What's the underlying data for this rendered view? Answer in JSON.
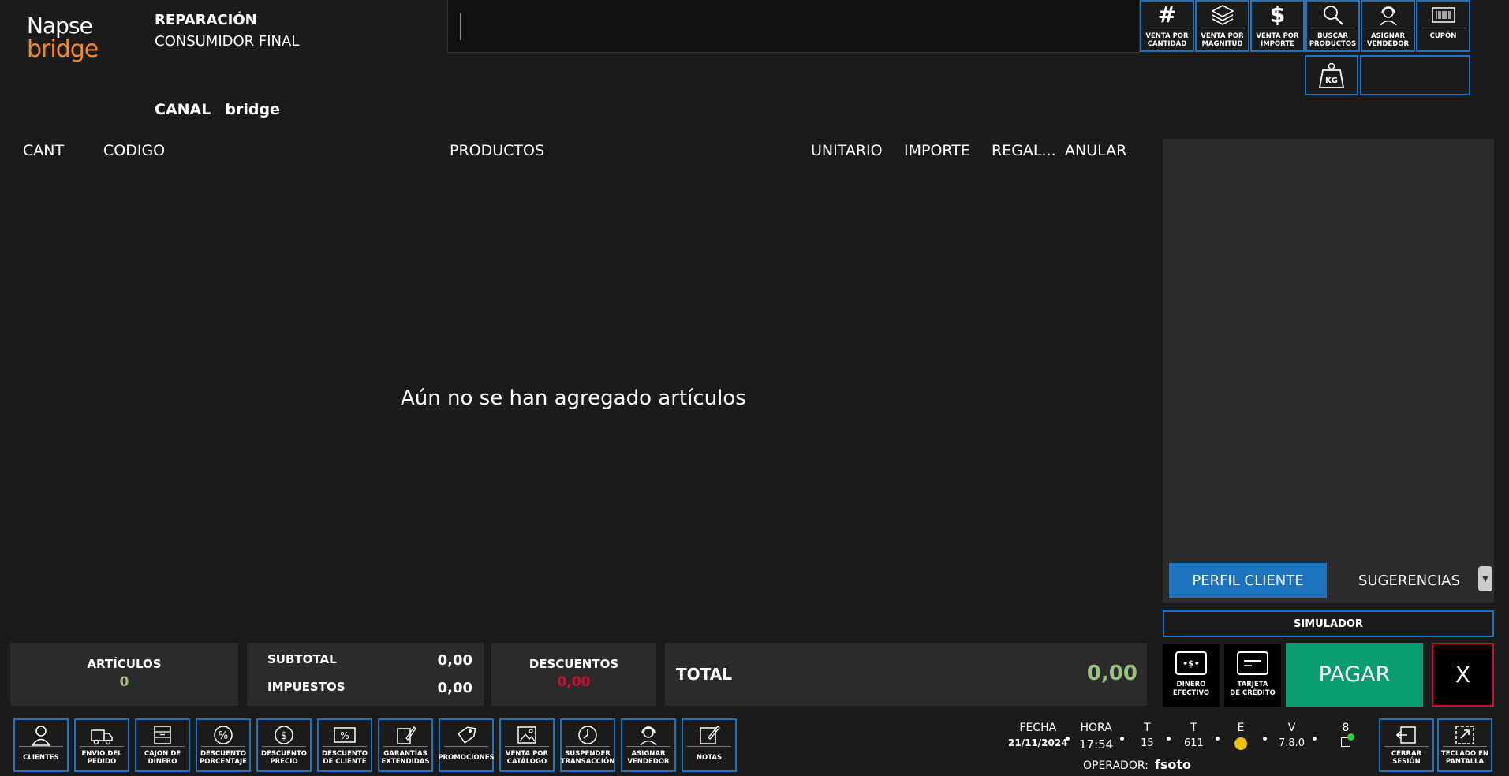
{
  "logo": {
    "line1": "Napse",
    "line2": "bridge"
  },
  "header": {
    "title": "REPARACIÓN",
    "subtitle": "CONSUMIDOR FINAL",
    "canal_label": "CANAL",
    "canal_value": "bridge"
  },
  "toolbar": [
    {
      "icon": "#",
      "label1": "VENTA POR",
      "label2": "CANTIDAD"
    },
    {
      "icon": "layers",
      "label1": "VENTA POR",
      "label2": "MAGNITUD"
    },
    {
      "icon": "$",
      "label1": "VENTA POR",
      "label2": "IMPORTE"
    },
    {
      "icon": "search",
      "label1": "BUSCAR",
      "label2": "PRODUCTOS"
    },
    {
      "icon": "headset",
      "label1": "ASIGNAR",
      "label2": "VENDEDOR"
    },
    {
      "icon": "barcode",
      "label1": "CUPÓN",
      "label2": ""
    }
  ],
  "kg_label": "KG",
  "table": {
    "columns": [
      "CANT",
      "CODIGO",
      "PRODUCTOS",
      "UNITARIO",
      "IMPORTE",
      "REGAL...",
      "ANULAR"
    ],
    "empty_message": "Aún no se han agregado artículos"
  },
  "tabs": {
    "perfil": "PERFIL CLIENTE",
    "sugerencias": "SUGERENCIAS"
  },
  "simulador": "SIMULADOR",
  "summary": {
    "articulos_label": "ARTÍCULOS",
    "articulos_value": "0",
    "subtotal_label": "SUBTOTAL",
    "subtotal_value": "0,00",
    "impuestos_label": "IMPUESTOS",
    "impuestos_value": "0,00",
    "descuentos_label": "DESCUENTOS",
    "descuentos_value": "0,00",
    "total_label": "TOTAL",
    "total_value": "0,00"
  },
  "payment": {
    "efectivo1": "DINERO",
    "efectivo2": "EFECTIVO",
    "tarjeta1": "TARJETA",
    "tarjeta2": "DE CRÉDITO",
    "pagar": "PAGAR",
    "cancel": "X"
  },
  "bottom_buttons": [
    {
      "label1": "CLIENTES",
      "label2": ""
    },
    {
      "label1": "ENVIO DEL",
      "label2": "PEDIDO"
    },
    {
      "label1": "CAJON DE",
      "label2": "DINERO"
    },
    {
      "label1": "DESCUENTO",
      "label2": "PORCENTAJE"
    },
    {
      "label1": "DESCUENTO",
      "label2": "PRECIO"
    },
    {
      "label1": "DESCUENTO",
      "label2": "DE CLIENTE"
    },
    {
      "label1": "GARANTÍAS",
      "label2": "EXTENDIDAS"
    },
    {
      "label1": "PROMOCIONES",
      "label2": ""
    },
    {
      "label1": "VENTA POR",
      "label2": "CATÁLOGO"
    },
    {
      "label1": "SUSPENDER",
      "label2": "TRANSACCIÓN"
    },
    {
      "label1": "ASIGNAR",
      "label2": "VENDEDOR"
    },
    {
      "label1": "NOTAS",
      "label2": ""
    }
  ],
  "status": {
    "fecha_label": "FECHA",
    "fecha_value": "21/11/2024",
    "hora_label": "HORA",
    "hora_value": "17:54",
    "t1_label": "T",
    "t1_value": "15",
    "t2_label": "T",
    "t2_value": "611",
    "e_label": "E",
    "v_label": "V",
    "v_value": "7.8.0",
    "n_label": "8",
    "operador_label": "OPERADOR:",
    "operador_value": "fsoto"
  },
  "right_buttons": [
    {
      "label1": "CERRAR",
      "label2": "SESIÓN"
    },
    {
      "label1": "TECLADO EN",
      "label2": "PANTALLA"
    }
  ],
  "colors": {
    "accent": "#1e73be",
    "pay": "#0a9d72",
    "danger": "#c8102e",
    "positive": "#9ac083",
    "brand_orange": "#f28a2a"
  }
}
